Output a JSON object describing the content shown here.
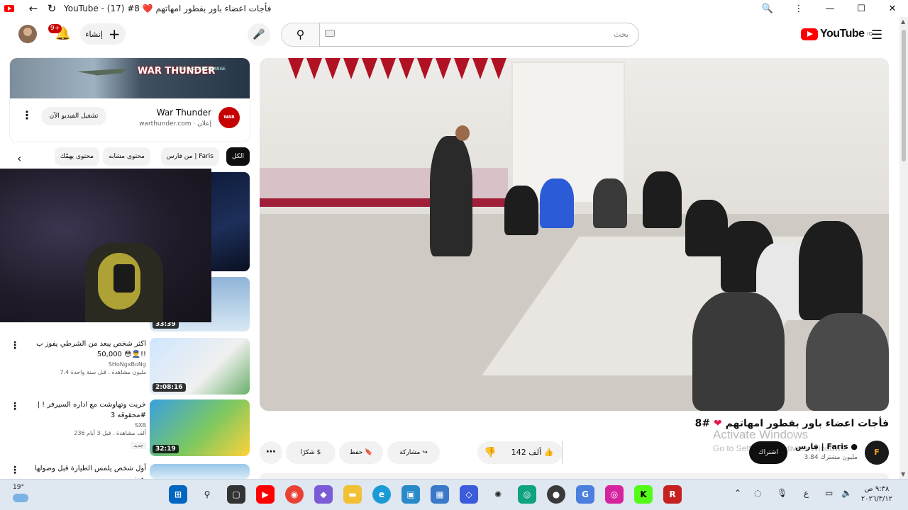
{
  "window": {
    "tab_title": "YouTube - فأجات اعضاء باور بفطور امهاتهم ❤️ 8# (17)",
    "zoom_icon": "zoom-icon",
    "more_icon": "kebab-icon"
  },
  "header": {
    "notifications_count": "9+",
    "create_label": "إنشاء",
    "search_placeholder": "بحث",
    "logo_text": "YouTube",
    "logo_region": "IQ"
  },
  "ad": {
    "title": "War Thunder",
    "sponsor_label": "إعلان",
    "domain": "warthunder.com",
    "cta": "تشغيل الفيديو الآن",
    "banner_brand": "WAR THUNDER",
    "banner_text": "THE SHOOTING RANGE",
    "logo_text": "WAR THUNDER"
  },
  "chips": [
    "الكل",
    "من فارس | Faris",
    "محتوى مشابه",
    "محتوى يهمّك"
  ],
  "related": [
    {
      "title": "",
      "channel": "",
      "meta": "",
      "duration": "33:39"
    },
    {
      "title": "اكثر شخص يبعد من الشرطي يفوز ب 50,000 😳👮‍♂️!!",
      "channel": "SHoNgxBoNg",
      "meta": "7.4 مليون مشاهدة . قبل سنة واحدة",
      "duration": "2:08:16"
    },
    {
      "title": "خربت وتهاوشت مع اداره السيرفر ! | محقوقه 3#",
      "channel": "SXB",
      "meta": "236 ألف مشاهدة . قبل 3 أيام",
      "badge": "جديد",
      "duration": "32:19"
    },
    {
      "title": "أول شخص يلمس الطيارة قبل وصولها يفوز",
      "channel": "",
      "meta": "",
      "duration": ""
    }
  ],
  "video": {
    "title": "فأجات اعضاء باور بفطور امهاتهم",
    "title_suffix": "8#",
    "channel": "فارس | Faris",
    "subscribers": "3.84 مليون مشترك",
    "subscribe_label": "اشتراك",
    "likes": "142 ألف",
    "share_label": "مشاركة",
    "save_label": "حفظ",
    "thanks_label": "شكرًا"
  },
  "watermark": {
    "line1": "Activate Windows",
    "line2": "Go to Settings to activate Windows."
  },
  "taskbar": {
    "weather": "19°",
    "lang": "ع",
    "time": "٩:٣٨ ص",
    "date": "٢٠٢٦/٣/١٢"
  }
}
